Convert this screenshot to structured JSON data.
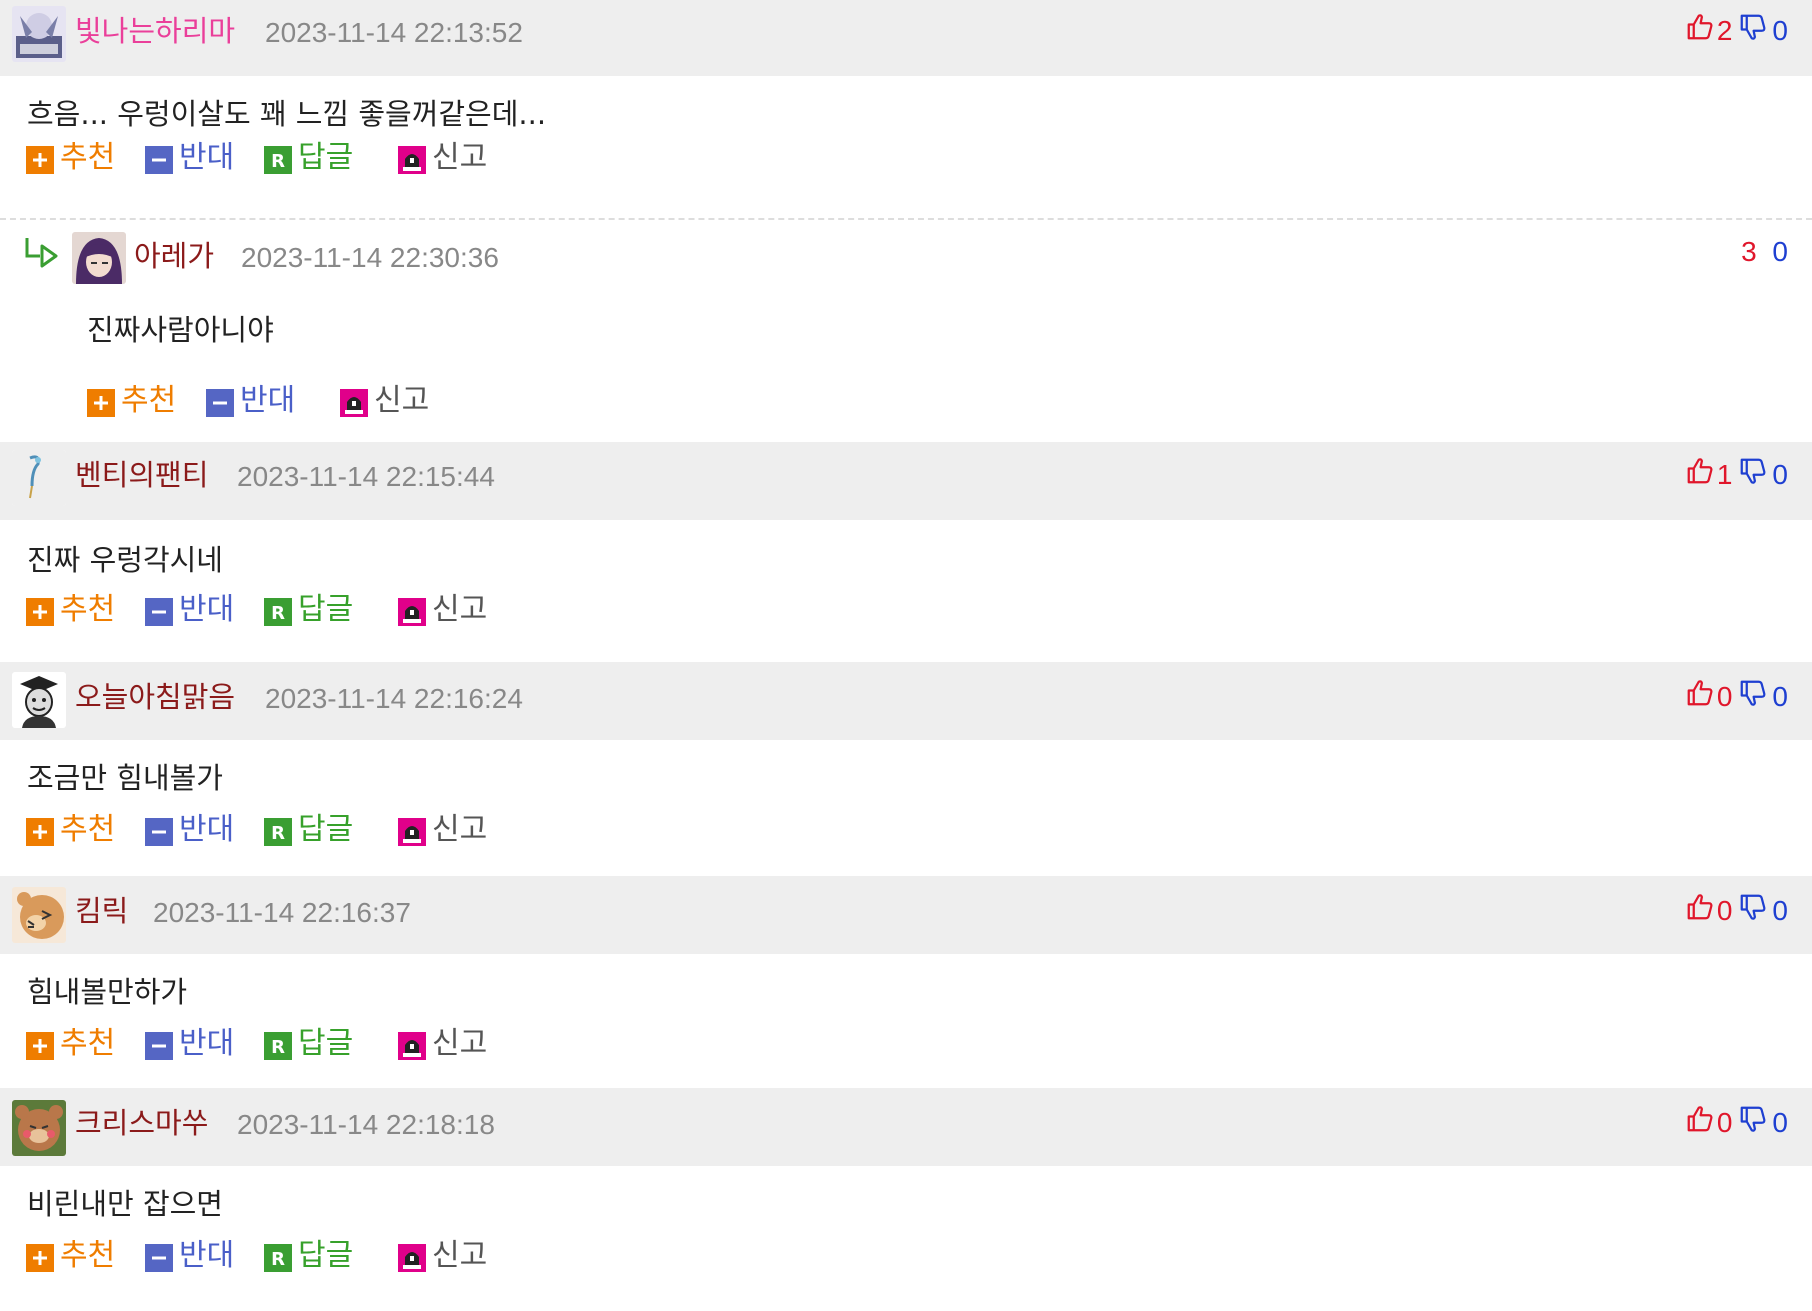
{
  "labels": {
    "recommend": "추천",
    "oppose": "반대",
    "reply": "답글",
    "report": "신고"
  },
  "colors": {
    "header_bg": "#eeeeee",
    "recommend": "#ef7d00",
    "oppose": "#4a5fc8",
    "reply": "#37a12b",
    "report_icon": "#e0008a",
    "up": "#e0162b",
    "down": "#1e3fd1"
  },
  "comments": [
    {
      "nick": "빛나는하리마",
      "nick_color": "#ea3f9a",
      "time": "2023-11-14 22:13:52",
      "up": "2",
      "down": "0",
      "text": "흐음... 우렁이살도 꽤 느낌 좋을꺼같은데...",
      "avatar_icon": "anime-avatar-icon",
      "reply": {
        "nick": "아레가",
        "nick_color": "#8b1a1a",
        "time": "2023-11-14 22:30:36",
        "up": "3",
        "down": "0",
        "text": "진짜사람아니야",
        "avatar_icon": "purple-hair-avatar-icon"
      }
    },
    {
      "nick": "벤티의팬티",
      "nick_color": "#8b1a1a",
      "time": "2023-11-14 22:15:44",
      "up": "1",
      "down": "0",
      "text": "진짜 우렁각시네",
      "avatar_icon": "feather-avatar-icon"
    },
    {
      "nick": "오늘아침맑음",
      "nick_color": "#8b1a1a",
      "time": "2023-11-14 22:16:24",
      "up": "0",
      "down": "0",
      "text": "조금만 힘내볼가",
      "avatar_icon": "graduate-avatar-icon"
    },
    {
      "nick": "킴릭",
      "nick_color": "#8b1a1a",
      "time": "2023-11-14 22:16:37",
      "up": "0",
      "down": "0",
      "text": "힘내볼만하가",
      "avatar_icon": "bear-avatar-icon"
    },
    {
      "nick": "크리스마쑤",
      "nick_color": "#8b1a1a",
      "time": "2023-11-14 22:18:18",
      "up": "0",
      "down": "0",
      "text": "비린내만 잡으면",
      "avatar_icon": "blush-bear-avatar-icon"
    }
  ]
}
